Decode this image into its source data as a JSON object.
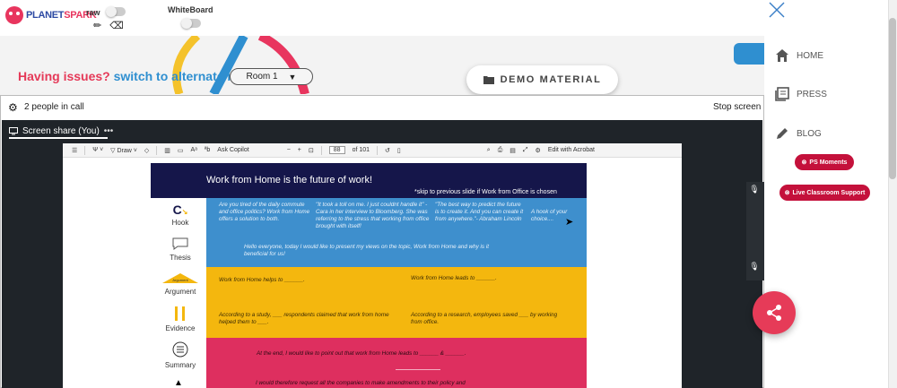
{
  "header": {
    "logo_text_a": "PLANET",
    "logo_text_b": "SPARK",
    "draw_label": "raw",
    "whiteboard_label": "WhiteBoard"
  },
  "room_bar": {
    "issue_text": "Having issues?",
    "issue_link": "switch to alternate room",
    "room_value": "Room 1",
    "demo_button": "DEMO MATERIAL"
  },
  "call": {
    "people_count": "2 people in call",
    "stop_share": "Stop screen",
    "share_tab": "Screen share (You)"
  },
  "pdf_toolbar": {
    "draw": "Draw",
    "ask_copilot": "Ask Copilot",
    "page_current": "88",
    "page_total": "of 101",
    "edit_acrobat": "Edit with Acrobat"
  },
  "slide": {
    "title": "Work from Home is the future of work!",
    "subtitle": "*skip to previous slide if Work from Office is chosen",
    "rail": {
      "hook": "Hook",
      "thesis": "Thesis",
      "argument": "Argument",
      "argument_badge": "Argument",
      "evidence": "Evidence",
      "summary": "Summary"
    },
    "hook_1": "Are you tired of the daily commute and office politics? Work from Home offers a solution to both.",
    "hook_2": "\"It took a toll on me. I just couldnt handle it\" - Cara in her interview to Bloomberg. She was referring to the stress that working from office brought with itself!",
    "hook_3": "\"The best way to predict the future is to create it. And you can create it from anywhere.\"- Abraham Lincoln",
    "hook_4": "A hook of your choice....",
    "thesis_text": "Hello everyone, today I would like to present my views on the topic, Work from Home and why is it beneficial for us!",
    "argument_left": "Work from Home helps to ______.",
    "argument_right": "Work from Home leads to ______.",
    "evidence_left": "According to a study, ___ respondents claimed that work from home helped them to ___.",
    "evidence_right": "According to a research, employees saved ___ by working from office.",
    "summary_1": "At the end, I would like to point out that work from Home leads to ______ & ______.",
    "summary_2": "I would therefore request all the companies to make amendments to their policy and"
  },
  "nav": {
    "home": "HOME",
    "press": "PRESS",
    "blog": "BLOG",
    "ps_moments": "PS Moments",
    "live_support": "Live Classroom Support"
  },
  "colors": {
    "brand_red": "#e53958",
    "brand_blue": "#2f8fd0",
    "slide_navy": "#15164a",
    "band_blue": "#3e8fcd",
    "band_yellow": "#f4b70e",
    "band_red": "#de2f5f"
  }
}
